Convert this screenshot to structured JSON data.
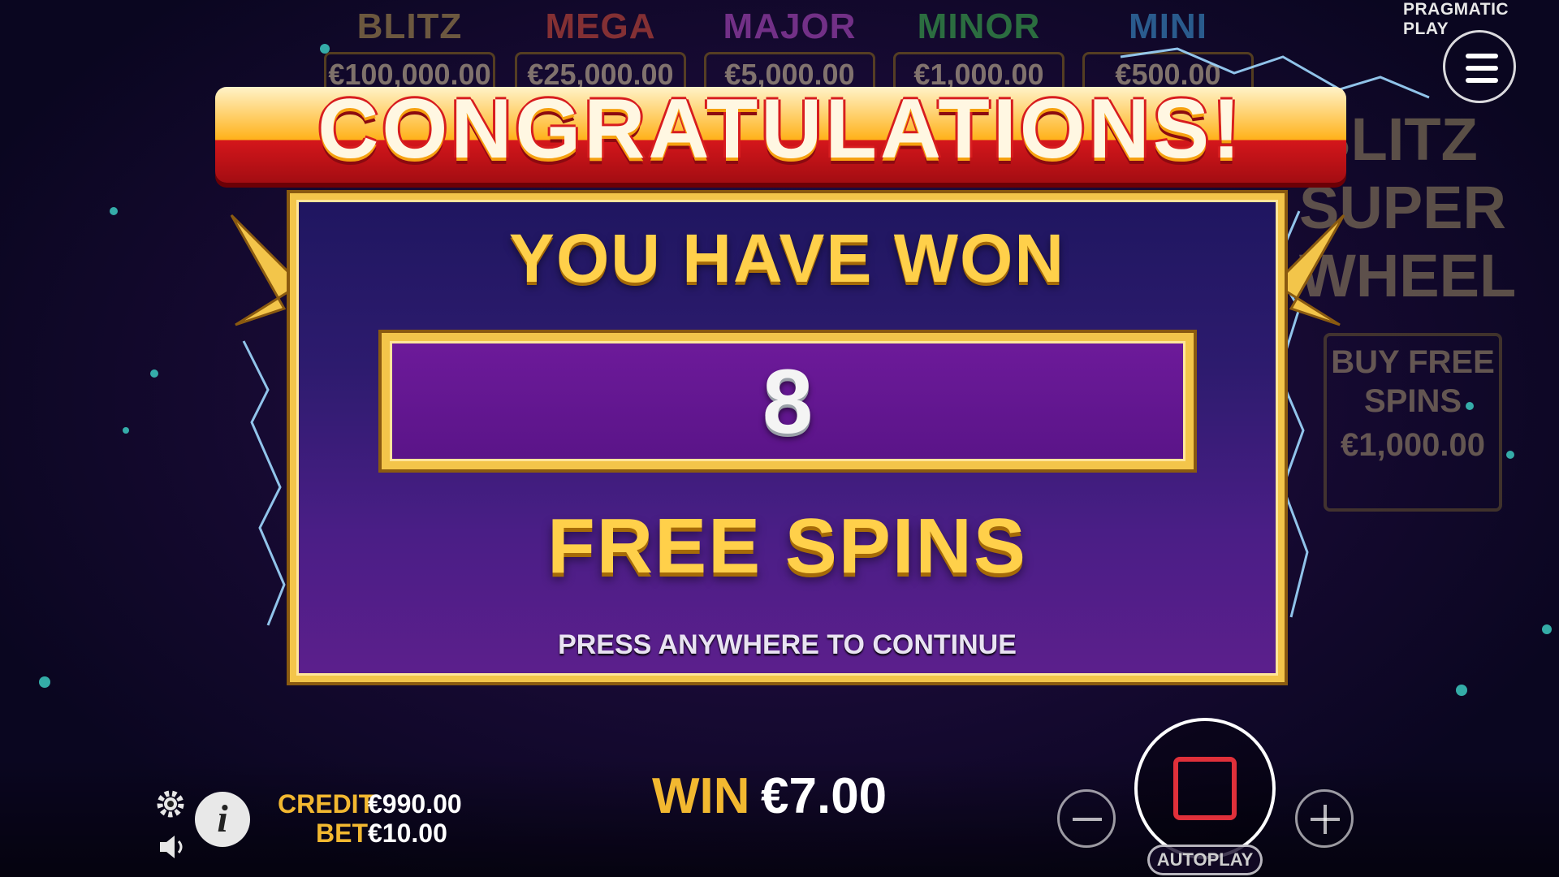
{
  "brand": "PRAGMATIC PLAY",
  "jackpots": [
    {
      "name": "BLITZ",
      "value": "€100,000.00",
      "color": "#b89a52"
    },
    {
      "name": "MEGA",
      "value": "€25,000.00",
      "color": "#e0503a"
    },
    {
      "name": "MAJOR",
      "value": "€5,000.00",
      "color": "#c050d0"
    },
    {
      "name": "MINOR",
      "value": "€1,000.00",
      "color": "#40c050"
    },
    {
      "name": "MINI",
      "value": "€500.00",
      "color": "#40a0e0"
    }
  ],
  "side": {
    "title": "BLITZ SUPER WHEEL",
    "buy_label": "BUY FREE SPINS",
    "buy_price": "€1,000.00"
  },
  "popup": {
    "headline": "CONGRATULATIONS!",
    "won_text": "YOU HAVE WON",
    "count": "8",
    "reward": "FREE SPINS",
    "prompt": "PRESS ANYWHERE TO CONTINUE"
  },
  "footer": {
    "credit_label": "CREDIT",
    "credit_value": "€990.00",
    "bet_label": "BET",
    "bet_value": "€10.00",
    "win_label": "WIN",
    "win_value": "€7.00",
    "autoplay_label": "AUTOPLAY"
  },
  "icons": {
    "menu": "menu-icon",
    "settings": "gear-icon",
    "sound": "speaker-icon",
    "info": "info-icon",
    "minus": "minus-icon",
    "plus": "plus-icon",
    "stop": "stop-icon"
  },
  "colors": {
    "gold": "#f2b830",
    "spin_stop": "#e0303a",
    "panel_frame": "#f3c54a"
  }
}
